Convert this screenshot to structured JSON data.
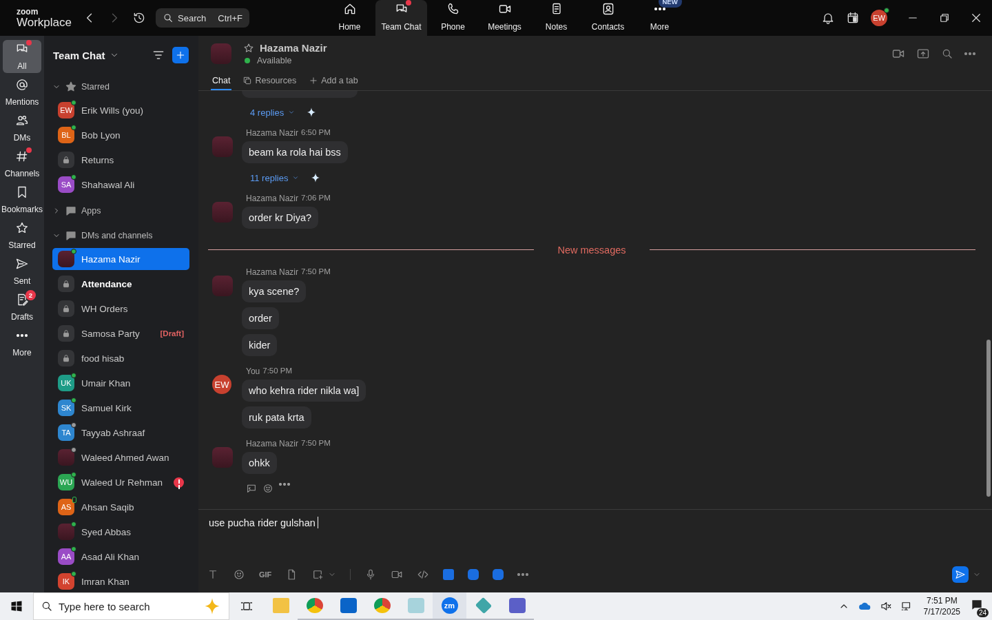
{
  "app": {
    "logo_top": "zoom",
    "logo_bottom": "Workplace"
  },
  "search": {
    "placeholder": "Search",
    "shortcut": "Ctrl+F"
  },
  "nav_tabs": [
    {
      "label": "Home",
      "selected": false,
      "dot": false
    },
    {
      "label": "Team Chat",
      "selected": true,
      "dot": true
    },
    {
      "label": "Phone",
      "selected": false,
      "dot": false
    },
    {
      "label": "Meetings",
      "selected": false,
      "dot": false
    },
    {
      "label": "Notes",
      "selected": false,
      "dot": false
    },
    {
      "label": "Contacts",
      "selected": false,
      "dot": false
    },
    {
      "label": "More",
      "selected": false,
      "dot": false,
      "badge": "NEW"
    }
  ],
  "account": {
    "initials": "EW",
    "color": "#c8412f",
    "presence": {
      "kind": "online"
    }
  },
  "rail": [
    {
      "label": "All",
      "selected": true,
      "dot": true
    },
    {
      "label": "Mentions",
      "selected": false,
      "dot": false
    },
    {
      "label": "DMs",
      "selected": false,
      "dot": false
    },
    {
      "label": "Channels",
      "selected": false,
      "dot": true
    },
    {
      "label": "Bookmarks",
      "selected": false,
      "dot": false
    },
    {
      "label": "Starred",
      "selected": false,
      "dot": false
    },
    {
      "label": "Sent",
      "selected": false,
      "dot": false
    },
    {
      "label": "Drafts",
      "selected": false,
      "dot": false,
      "badge": "2"
    },
    {
      "label": "More",
      "selected": false,
      "dot": false
    }
  ],
  "sidebar": {
    "title": "Team Chat",
    "sections": [
      {
        "label": "Starred",
        "expanded": true,
        "items": [
          {
            "name": "Erik Wills (you)",
            "kind": "user",
            "initials": "EW",
            "color": "#c8412f",
            "presence": {
              "kind": "online"
            },
            "selected": false,
            "unread": false,
            "alert": false
          },
          {
            "name": "Bob Lyon",
            "kind": "user",
            "initials": "BL",
            "color": "#de6417",
            "presence": {
              "kind": "online"
            },
            "selected": false,
            "unread": false,
            "alert": false
          },
          {
            "name": "Returns",
            "kind": "channel",
            "selected": false,
            "unread": false,
            "alert": false
          },
          {
            "name": "Shahawal Ali",
            "kind": "user",
            "initials": "SA",
            "color": "#9a4cc6",
            "presence": {
              "kind": "online"
            },
            "selected": false,
            "unread": false,
            "alert": false
          }
        ]
      },
      {
        "label": "Apps",
        "expanded": false
      },
      {
        "label": "DMs and channels",
        "expanded": true,
        "items": [
          {
            "name": "Hazama Nazir",
            "kind": "photo",
            "presence": {
              "kind": "online"
            },
            "selected": true,
            "unread": false,
            "alert": false
          },
          {
            "name": "Attendance",
            "kind": "channel",
            "selected": false,
            "unread": true,
            "alert": false
          },
          {
            "name": "WH Orders",
            "kind": "channel",
            "selected": false,
            "unread": false,
            "alert": false
          },
          {
            "name": "Samosa Party",
            "kind": "channel",
            "selected": false,
            "unread": false,
            "alert": false,
            "tag": "[Draft]"
          },
          {
            "name": "food hisab",
            "kind": "channel",
            "selected": false,
            "unread": false,
            "alert": false
          },
          {
            "name": "Umair Khan",
            "kind": "user",
            "initials": "UK",
            "color": "#1e9c87",
            "presence": {
              "kind": "online"
            },
            "selected": false,
            "unread": false,
            "alert": false
          },
          {
            "name": "Samuel Kirk",
            "kind": "user",
            "initials": "SK",
            "color": "#2e86cf",
            "presence": {
              "kind": "online"
            },
            "selected": false,
            "unread": false,
            "alert": false
          },
          {
            "name": "Tayyab Ashraaf",
            "kind": "user",
            "initials": "TA",
            "color": "#2e86cf",
            "presence": {
              "kind": "away"
            },
            "selected": false,
            "unread": false,
            "alert": false
          },
          {
            "name": "Waleed Ahmed Awan",
            "kind": "photo",
            "presence": {
              "kind": "away"
            },
            "selected": false,
            "unread": false,
            "alert": false
          },
          {
            "name": "Waleed Ur Rehman",
            "kind": "user",
            "initials": "WU",
            "color": "#2ba653",
            "presence": {
              "kind": "online"
            },
            "selected": false,
            "unread": false,
            "alert": true
          },
          {
            "name": "Ahsan Saqib",
            "kind": "user",
            "initials": "AS",
            "color": "#de6417",
            "presence": {
              "kind": "mobile"
            },
            "selected": false,
            "unread": false,
            "alert": false
          },
          {
            "name": "Syed Abbas",
            "kind": "photo",
            "presence": {
              "kind": "online"
            },
            "selected": false,
            "unread": false,
            "alert": false
          },
          {
            "name": "Asad Ali Khan",
            "kind": "user",
            "initials": "AA",
            "color": "#9a4cc6",
            "presence": {
              "kind": "online"
            },
            "selected": false,
            "unread": false,
            "alert": false
          },
          {
            "name": "Imran Khan",
            "kind": "user",
            "initials": "IK",
            "color": "#d2432f",
            "presence": {
              "kind": "online"
            },
            "selected": false,
            "unread": false,
            "alert": false
          }
        ]
      }
    ]
  },
  "chat": {
    "contact": {
      "name": "Hazama Nazir",
      "status": "Available",
      "starred": false
    },
    "tabs": [
      {
        "label": "Chat",
        "selected": true
      },
      {
        "label": "Resources",
        "selected": false
      },
      {
        "label": "Add a tab",
        "selected": false
      }
    ],
    "messages": [
      {
        "kind": "replies",
        "replies": "4 replies"
      },
      {
        "kind": "message",
        "sender": "Hazama Nazir",
        "time": "6:50 PM",
        "avatar": {
          "kind": "photo"
        },
        "bubbles": [
          "beam ka rola hai bss"
        ],
        "replies": "11 replies",
        "actions": false
      },
      {
        "kind": "message",
        "sender": "Hazama Nazir",
        "time": "7:06 PM",
        "avatar": {
          "kind": "photo"
        },
        "bubbles": [
          "order kr Diya?"
        ],
        "actions": false
      },
      {
        "kind": "divider",
        "label": "New messages"
      },
      {
        "kind": "message",
        "sender": "Hazama Nazir",
        "time": "7:50 PM",
        "avatar": {
          "kind": "photo"
        },
        "bubbles": [
          "kya scene?",
          "order",
          "kider"
        ],
        "actions": false
      },
      {
        "kind": "message",
        "sender": "You",
        "time": "7:50 PM",
        "avatar": {
          "kind": "initials",
          "initials": "EW",
          "color": "#c8412f"
        },
        "bubbles": [
          "who kehra rider nikla wa]",
          "ruk pata krta"
        ],
        "actions": false
      },
      {
        "kind": "message",
        "sender": "Hazama Nazir",
        "time": "7:50 PM",
        "avatar": {
          "kind": "photo"
        },
        "bubbles": [
          "ohkk"
        ],
        "actions": true
      }
    ],
    "composer": {
      "value": "use pucha rider gulshan",
      "gif": "GIF"
    }
  },
  "taskbar": {
    "search_placeholder": "Type here to search",
    "zoom_label": "zm",
    "time": "7:51 PM",
    "date": "7/17/2025",
    "notifications": "24"
  }
}
